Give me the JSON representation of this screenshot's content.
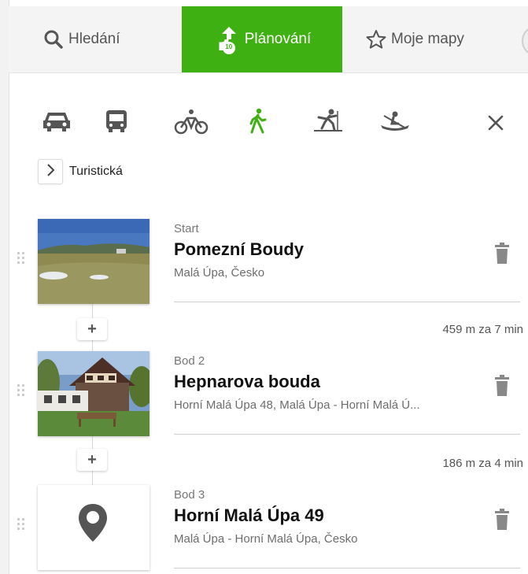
{
  "tabs": {
    "search": "Hledání",
    "planning": "Plánování",
    "planning_badge": "10",
    "my_maps": "Moje mapy"
  },
  "transport_modes": [
    {
      "icon": "car-icon",
      "active": false
    },
    {
      "icon": "bus-icon",
      "active": false
    },
    {
      "icon": "bicycle-icon",
      "active": false
    },
    {
      "icon": "walking-icon",
      "active": true
    },
    {
      "icon": "skiing-icon",
      "active": false
    },
    {
      "icon": "canoe-icon",
      "active": false
    }
  ],
  "colors": {
    "accent": "#3fb011",
    "icon_gray": "#555555"
  },
  "route_type": "Turistická",
  "waypoints": [
    {
      "label": "Start",
      "name": "Pomezní Boudy",
      "address": "Malá Úpa, Česko"
    },
    {
      "label": "Bod 2",
      "name": "Hepnarova bouda",
      "address": "Horní Malá Úpa 48, Malá Úpa - Horní Malá Ú..."
    },
    {
      "label": "Bod 3",
      "name": "Horní Malá Úpa 49",
      "address": "Malá Úpa - Horní Malá Úpa, Česko"
    }
  ],
  "add_label": "+",
  "segments": [
    "459 m za 7 min",
    "186 m za 4 min"
  ]
}
